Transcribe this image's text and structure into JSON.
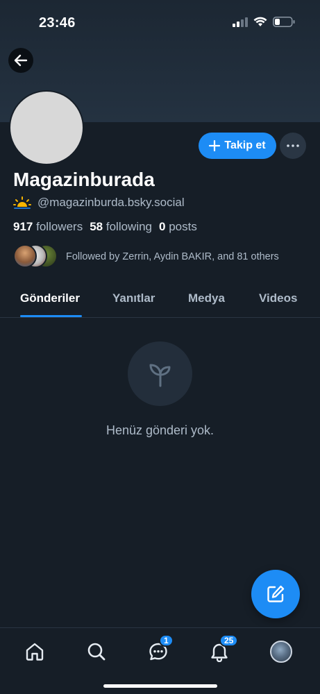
{
  "status_bar": {
    "time": "23:46"
  },
  "profile": {
    "display_name": "Magazinburada",
    "handle": "@magazinburda.bsky.social",
    "handle_emoji": "🌅",
    "followers_count": "917",
    "followers_label": "followers",
    "following_count": "58",
    "following_label": "following",
    "posts_count": "0",
    "posts_label": "posts",
    "followed_by": "Followed by Zerrin, Aydin BAKIR, and 81 others"
  },
  "actions": {
    "follow_label": "Takip et"
  },
  "tabs": [
    {
      "label": "Gönderiler",
      "active": true
    },
    {
      "label": "Yanıtlar",
      "active": false
    },
    {
      "label": "Medya",
      "active": false
    },
    {
      "label": "Videos",
      "active": false
    }
  ],
  "empty_state": {
    "text": "Henüz gönderi yok."
  },
  "bottom_nav": {
    "messages_badge": "1",
    "notifications_badge": "25"
  },
  "colors": {
    "background": "#161e27",
    "accent": "#1d8cf5",
    "muted_text": "#aebbc9"
  }
}
